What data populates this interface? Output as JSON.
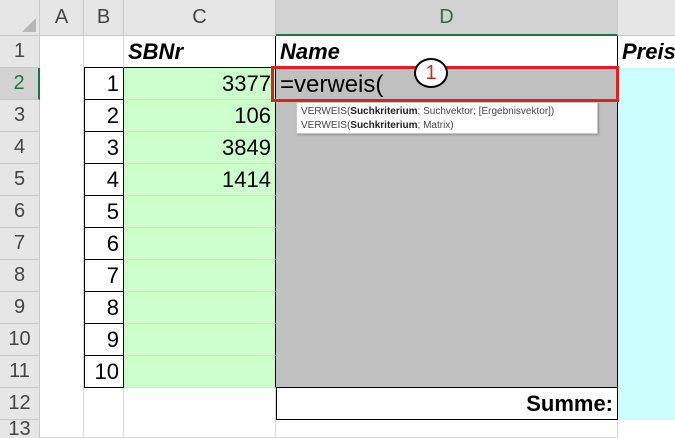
{
  "column_headers": [
    "A",
    "B",
    "C",
    "D"
  ],
  "row_headers": [
    "1",
    "2",
    "3",
    "4",
    "5",
    "6",
    "7",
    "8",
    "9",
    "10",
    "11",
    "12",
    "13"
  ],
  "header_row": {
    "c": "SBNr",
    "d": "Name",
    "e": "Preis"
  },
  "b_values": [
    "1",
    "2",
    "3",
    "4",
    "5",
    "6",
    "7",
    "8",
    "9",
    "10"
  ],
  "c_values": [
    "3377",
    "106",
    "3849",
    "1414"
  ],
  "formula_input": "=verweis(",
  "tooltip": {
    "line1": {
      "func": "VERWEIS(",
      "arg": "Suchkriterium",
      "rest": "; Suchvektor; [Ergebnisvektor])"
    },
    "line2": {
      "func": "VERWEIS(",
      "arg": "Suchkriterium",
      "rest": "; Matrix)"
    }
  },
  "summe_label": "Summe:",
  "marker_label": "1",
  "colors": {
    "green_fill": "#ccffcc",
    "gray_fill": "#c0c0c0",
    "cyan_fill": "#ccffff",
    "highlight_red": "#e02020",
    "selected_header": "#217346"
  }
}
